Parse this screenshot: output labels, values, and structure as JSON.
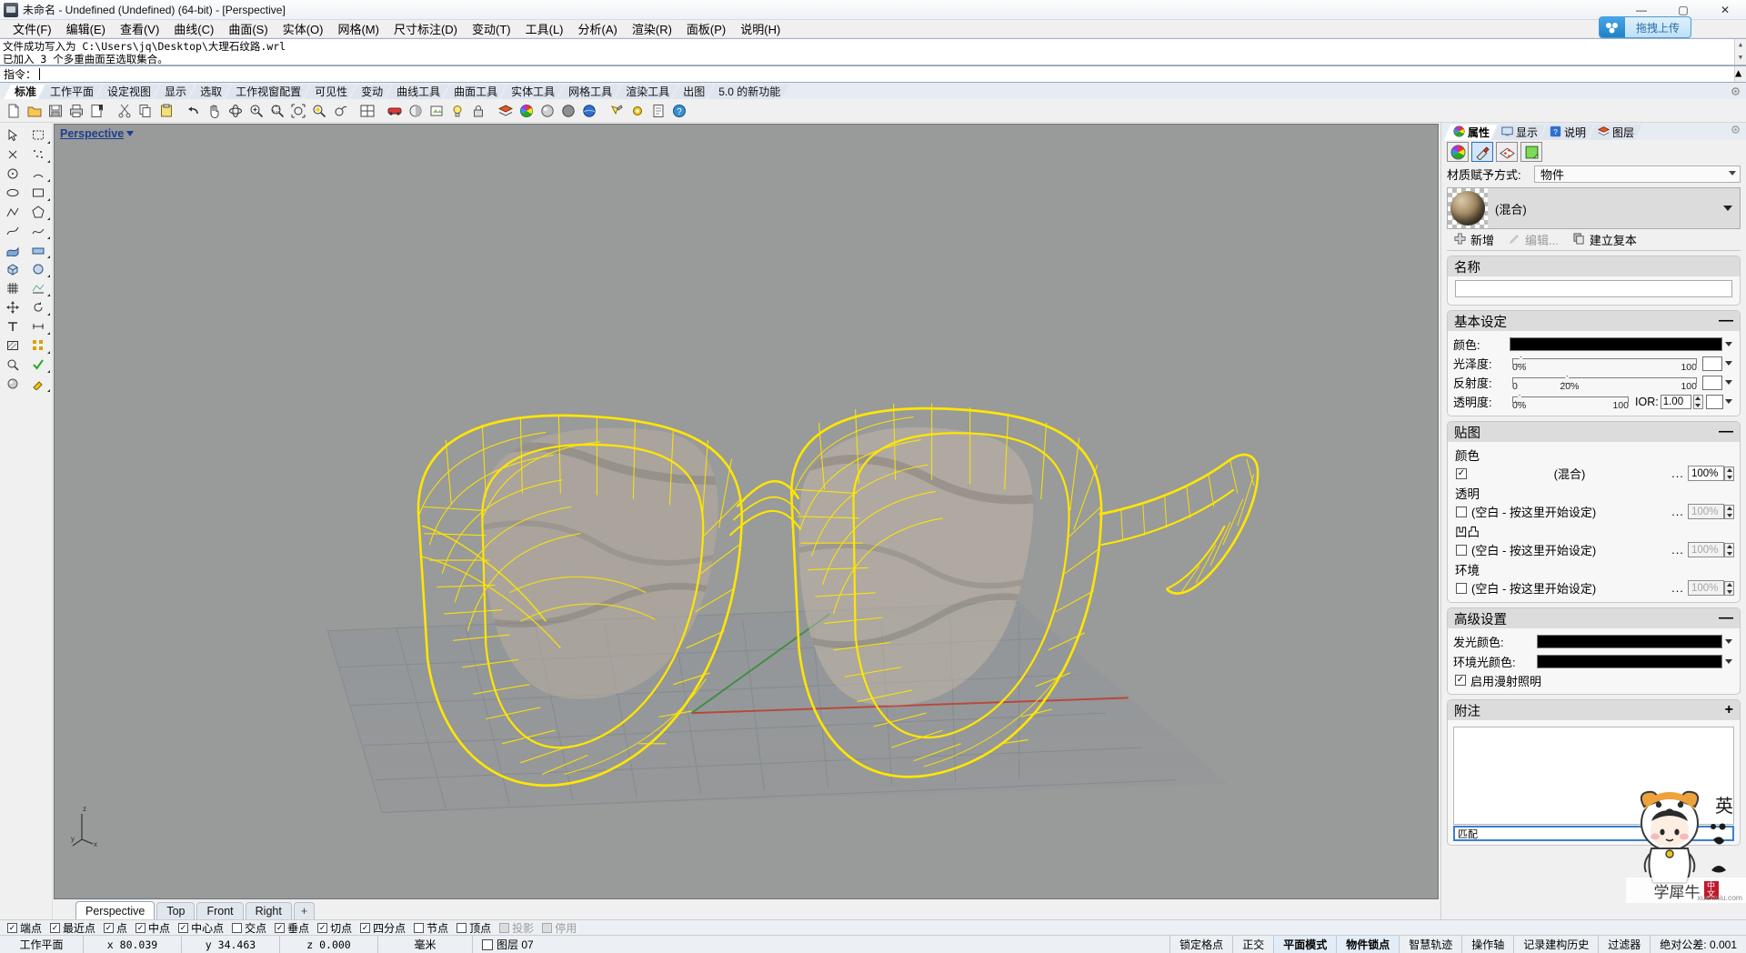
{
  "titlebar": {
    "icon": "rhino-app-icon",
    "title": "未命名 - Undefined (Undefined) (64-bit) - [Perspective]",
    "minimize": "—",
    "maximize": "▢",
    "close": "✕"
  },
  "menubar": {
    "items": [
      {
        "label": "文件(F)",
        "name": "menu-file"
      },
      {
        "label": "编辑(E)",
        "name": "menu-edit"
      },
      {
        "label": "查看(V)",
        "name": "menu-view"
      },
      {
        "label": "曲线(C)",
        "name": "menu-curve"
      },
      {
        "label": "曲面(S)",
        "name": "menu-surface"
      },
      {
        "label": "实体(O)",
        "name": "menu-solid"
      },
      {
        "label": "网格(M)",
        "name": "menu-mesh"
      },
      {
        "label": "尺寸标注(D)",
        "name": "menu-dimension"
      },
      {
        "label": "变动(T)",
        "name": "menu-transform"
      },
      {
        "label": "工具(L)",
        "name": "menu-tools"
      },
      {
        "label": "分析(A)",
        "name": "menu-analyze"
      },
      {
        "label": "渲染(R)",
        "name": "menu-render"
      },
      {
        "label": "面板(P)",
        "name": "menu-panels"
      },
      {
        "label": "说明(H)",
        "name": "menu-help"
      }
    ]
  },
  "upload_button": {
    "label": "拖拽上传"
  },
  "command_history": {
    "line1": "文件成功写入为 C:\\Users\\jq\\Desktop\\大理石纹路.wrl",
    "line2": "已加入 3 个多重曲面至选取集合。"
  },
  "command_prompt": {
    "label": "指令：",
    "value": ""
  },
  "toolbar_tabs": {
    "items": [
      {
        "label": "标准",
        "active": true
      },
      {
        "label": "工作平面",
        "active": false
      },
      {
        "label": "设定视图",
        "active": false
      },
      {
        "label": "显示",
        "active": false
      },
      {
        "label": "选取",
        "active": false
      },
      {
        "label": "工作视窗配置",
        "active": false
      },
      {
        "label": "可见性",
        "active": false
      },
      {
        "label": "变动",
        "active": false
      },
      {
        "label": "曲线工具",
        "active": false
      },
      {
        "label": "曲面工具",
        "active": false
      },
      {
        "label": "实体工具",
        "active": false
      },
      {
        "label": "网格工具",
        "active": false
      },
      {
        "label": "渲染工具",
        "active": false
      },
      {
        "label": "出图",
        "active": false
      },
      {
        "label": "5.0 的新功能",
        "active": false
      }
    ]
  },
  "viewport": {
    "label": "Perspective",
    "axis": {
      "z": "z",
      "y": "y",
      "x": "x"
    },
    "tabs": [
      {
        "label": "Perspective",
        "active": true
      },
      {
        "label": "Top",
        "active": false
      },
      {
        "label": "Front",
        "active": false
      },
      {
        "label": "Right",
        "active": false
      },
      {
        "label": "+",
        "active": false
      }
    ]
  },
  "right_panel": {
    "tabs": [
      {
        "label": "属性",
        "icon": "color-wheel-icon",
        "active": true
      },
      {
        "label": "显示",
        "icon": "monitor-icon",
        "active": false
      },
      {
        "label": "说明",
        "icon": "help-icon",
        "active": false
      },
      {
        "label": "图层",
        "icon": "layers-icon",
        "active": false
      }
    ],
    "icon_buttons": [
      {
        "name": "object-properties-icon",
        "selected": false
      },
      {
        "name": "material-icon",
        "selected": true
      },
      {
        "name": "texture-mapping-icon",
        "selected": false
      },
      {
        "name": "display-mode-icon",
        "selected": false
      }
    ],
    "assign_row": {
      "label": "材质赋予方式:",
      "value": "物件"
    },
    "material": {
      "name": "(混合)"
    },
    "material_buttons": {
      "add": "新增",
      "edit": "编辑...",
      "duplicate": "建立复本"
    },
    "name_group": {
      "title": "名称",
      "value": ""
    },
    "basic": {
      "title": "基本设定",
      "collapse": "—",
      "color_label": "颜色:",
      "color_value": "#000000",
      "gloss": {
        "label": "光泽度:",
        "min": "0%",
        "current": "0%",
        "max": "100",
        "pos": 2,
        "swatch": "#ffffff"
      },
      "reflect": {
        "label": "反射度:",
        "min": "0",
        "current": "20%",
        "max": "100",
        "pos": 20,
        "swatch": "#ffffff"
      },
      "transparency": {
        "label": "透明度:",
        "min": "0%",
        "current": "0%",
        "max": "100",
        "pos": 2,
        "swatch": "#ffffff"
      },
      "ior": {
        "label": "IOR:",
        "value": "1.00"
      }
    },
    "textures": {
      "title": "贴图",
      "collapse": "—",
      "rows": [
        {
          "label": "颜色",
          "checked": true,
          "value": "(混合)",
          "dots": "...",
          "pct": "100%",
          "dim": false
        },
        {
          "label": "透明",
          "checked": false,
          "value": "(空白 - 按这里开始设定)",
          "dots": "...",
          "pct": "100%",
          "dim": true
        },
        {
          "label": "凹凸",
          "checked": false,
          "value": "(空白 - 按这里开始设定)",
          "dots": "...",
          "pct": "100%",
          "dim": true
        },
        {
          "label": "环境",
          "checked": false,
          "value": "(空白 - 按这里开始设定)",
          "dots": "...",
          "pct": "100%",
          "dim": true
        }
      ]
    },
    "advanced": {
      "title": "高级设置",
      "collapse": "—",
      "emissive_label": "发光颜色:",
      "emissive_color": "#000000",
      "ambient_label": "环境光颜色:",
      "ambient_color": "#000000",
      "diffuse_label": "启用漫射照明",
      "diffuse_checked": true
    },
    "notes": {
      "title": "附注",
      "expand": "+",
      "value": ""
    },
    "url_field": {
      "value": "匹配"
    }
  },
  "watermark": {
    "text1": "英",
    "brand": "学犀牛",
    "badge": "中文",
    "site": "xuexiniu.com"
  },
  "osnap": {
    "items": [
      {
        "label": "端点",
        "checked": true,
        "disabled": false
      },
      {
        "label": "最近点",
        "checked": true,
        "disabled": false
      },
      {
        "label": "点",
        "checked": true,
        "disabled": false
      },
      {
        "label": "中点",
        "checked": true,
        "disabled": false
      },
      {
        "label": "中心点",
        "checked": true,
        "disabled": false
      },
      {
        "label": "交点",
        "checked": false,
        "disabled": false
      },
      {
        "label": "垂点",
        "checked": true,
        "disabled": false
      },
      {
        "label": "切点",
        "checked": true,
        "disabled": false
      },
      {
        "label": "四分点",
        "checked": true,
        "disabled": false
      },
      {
        "label": "节点",
        "checked": false,
        "disabled": false
      },
      {
        "label": "顶点",
        "checked": false,
        "disabled": false
      },
      {
        "label": "投影",
        "checked": false,
        "disabled": true
      },
      {
        "label": "停用",
        "checked": false,
        "disabled": true
      }
    ]
  },
  "statusbar": {
    "cplane": "工作平面",
    "x": "x  80.039",
    "y": "y  34.463",
    "z": "z  0.000",
    "units": "毫米",
    "layer": "图层 07",
    "grid_snap": "锁定格点",
    "ortho": "正交",
    "planar": "平面模式",
    "osnap": "物件锁点",
    "smarttrack": "智慧轨迹",
    "gumball": "操作轴",
    "history": "记录建构历史",
    "filter": "过滤器",
    "tolerance": "绝对公差: 0.001"
  },
  "colors": {
    "wire": "#ffe600",
    "ground": "#9a9a9a",
    "accent_blue": "#1b3f8f"
  }
}
